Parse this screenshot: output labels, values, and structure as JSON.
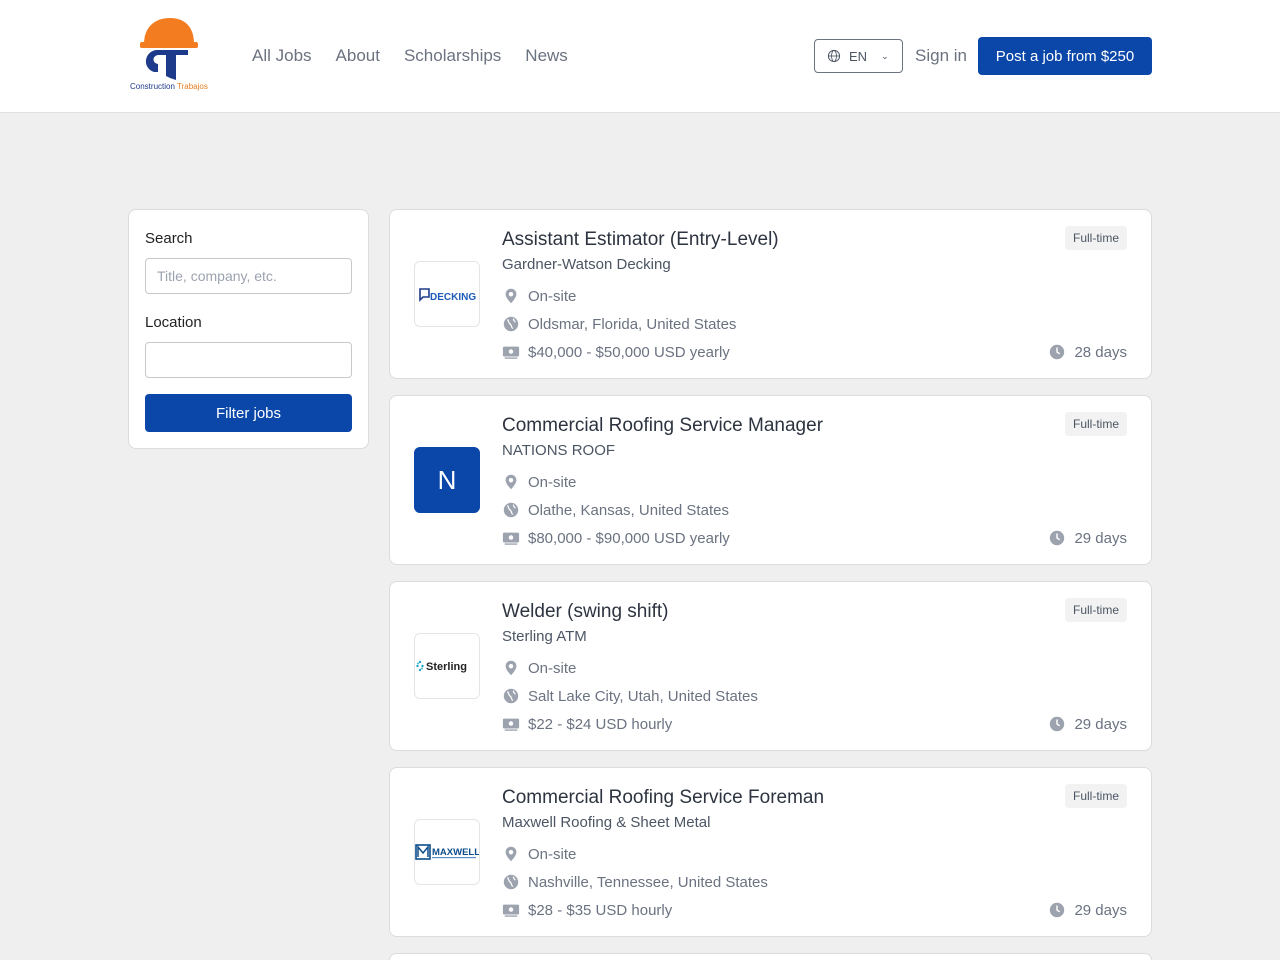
{
  "brand": {
    "logo_word1": "Construction",
    "logo_word2": "Trabajos"
  },
  "nav": {
    "items": [
      "All Jobs",
      "About",
      "Scholarships",
      "News"
    ]
  },
  "header": {
    "language": "EN",
    "sign_in": "Sign in",
    "post_job": "Post a job from $250"
  },
  "filter": {
    "search_label": "Search",
    "search_placeholder": "Title, company, etc.",
    "location_label": "Location",
    "location_value": "",
    "button": "Filter jobs"
  },
  "jobs": [
    {
      "title": "Assistant Estimator (Entry-Level)",
      "company": "Gardner-Watson Decking",
      "type": "Full-time",
      "workplace": "On-site",
      "location": "Oldsmar, Florida, United States",
      "salary": "$40,000 - $50,000 USD yearly",
      "posted": "28 days",
      "logo_text": "DECKING"
    },
    {
      "title": "Commercial Roofing Service Manager",
      "company": "NATIONS ROOF",
      "type": "Full-time",
      "workplace": "On-site",
      "location": "Olathe, Kansas, United States",
      "salary": "$80,000 - $90,000 USD yearly",
      "posted": "29 days",
      "logo_text": "N"
    },
    {
      "title": "Welder (swing shift)",
      "company": "Sterling ATM",
      "type": "Full-time",
      "workplace": "On-site",
      "location": "Salt Lake City, Utah, United States",
      "salary": "$22 - $24 USD hourly",
      "posted": "29 days",
      "logo_text": "Sterling"
    },
    {
      "title": "Commercial Roofing Service Foreman",
      "company": "Maxwell Roofing & Sheet Metal",
      "type": "Full-time",
      "workplace": "On-site",
      "location": "Nashville, Tennessee, United States",
      "salary": "$28 - $35 USD hourly",
      "posted": "29 days",
      "logo_text": "MAXWELL"
    }
  ],
  "colors": {
    "accent": "#0b47a8",
    "logo_orange": "#f47c20",
    "logo_navy": "#1e3a8a"
  }
}
